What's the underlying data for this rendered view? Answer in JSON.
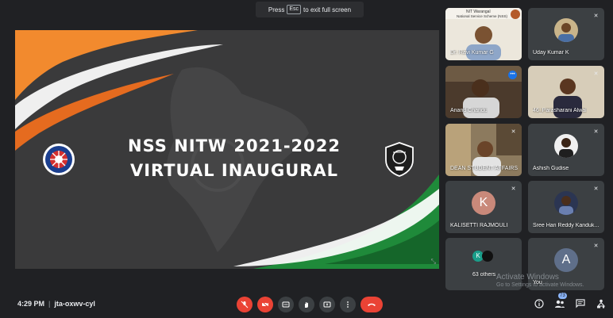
{
  "fullscreen_hint": {
    "pre": "Press",
    "key": "Esc",
    "post": "to exit full screen"
  },
  "slide": {
    "line1": "NSS NITW 2021-2022",
    "line2": "VIRTUAL INAUGURAL",
    "colors": {
      "orange": "#f28a2e",
      "green": "#1f8a3a",
      "bg": "#3a3a3b"
    }
  },
  "participants": [
    {
      "name": "Dr. Ravi Kumar G",
      "mic": "",
      "header": "NIT Warangal",
      "header2": "National Service Scheme (NSS)"
    },
    {
      "name": "Uday Kumar K",
      "mic": "muted-mic-icon"
    },
    {
      "name": "Anand Chandu",
      "mic": "speaking-icon"
    },
    {
      "name": "46_Parasharani Alwal",
      "mic": "muted-mic-icon"
    },
    {
      "name": "DEAN STUDENT AFFAIRS",
      "mic": "muted-mic-icon"
    },
    {
      "name": "Ashish Gudise",
      "mic": "muted-mic-icon"
    },
    {
      "name": "KALISETTI RAJMOULI",
      "mic": "muted-mic-icon",
      "initial": "K"
    },
    {
      "name": "Sree Hari Reddy Kanduk...",
      "mic": "muted-mic-icon"
    },
    {
      "name": "63 others",
      "initial": "K"
    },
    {
      "name": "You",
      "mic": "muted-mic-icon",
      "initial": "A"
    }
  ],
  "watermark": {
    "title": "Activate Windows",
    "sub": "Go to Settings to activate Windows."
  },
  "bottom": {
    "time": "4:29 PM",
    "code": "jta-oxwv-cyl",
    "people_count": "73"
  }
}
